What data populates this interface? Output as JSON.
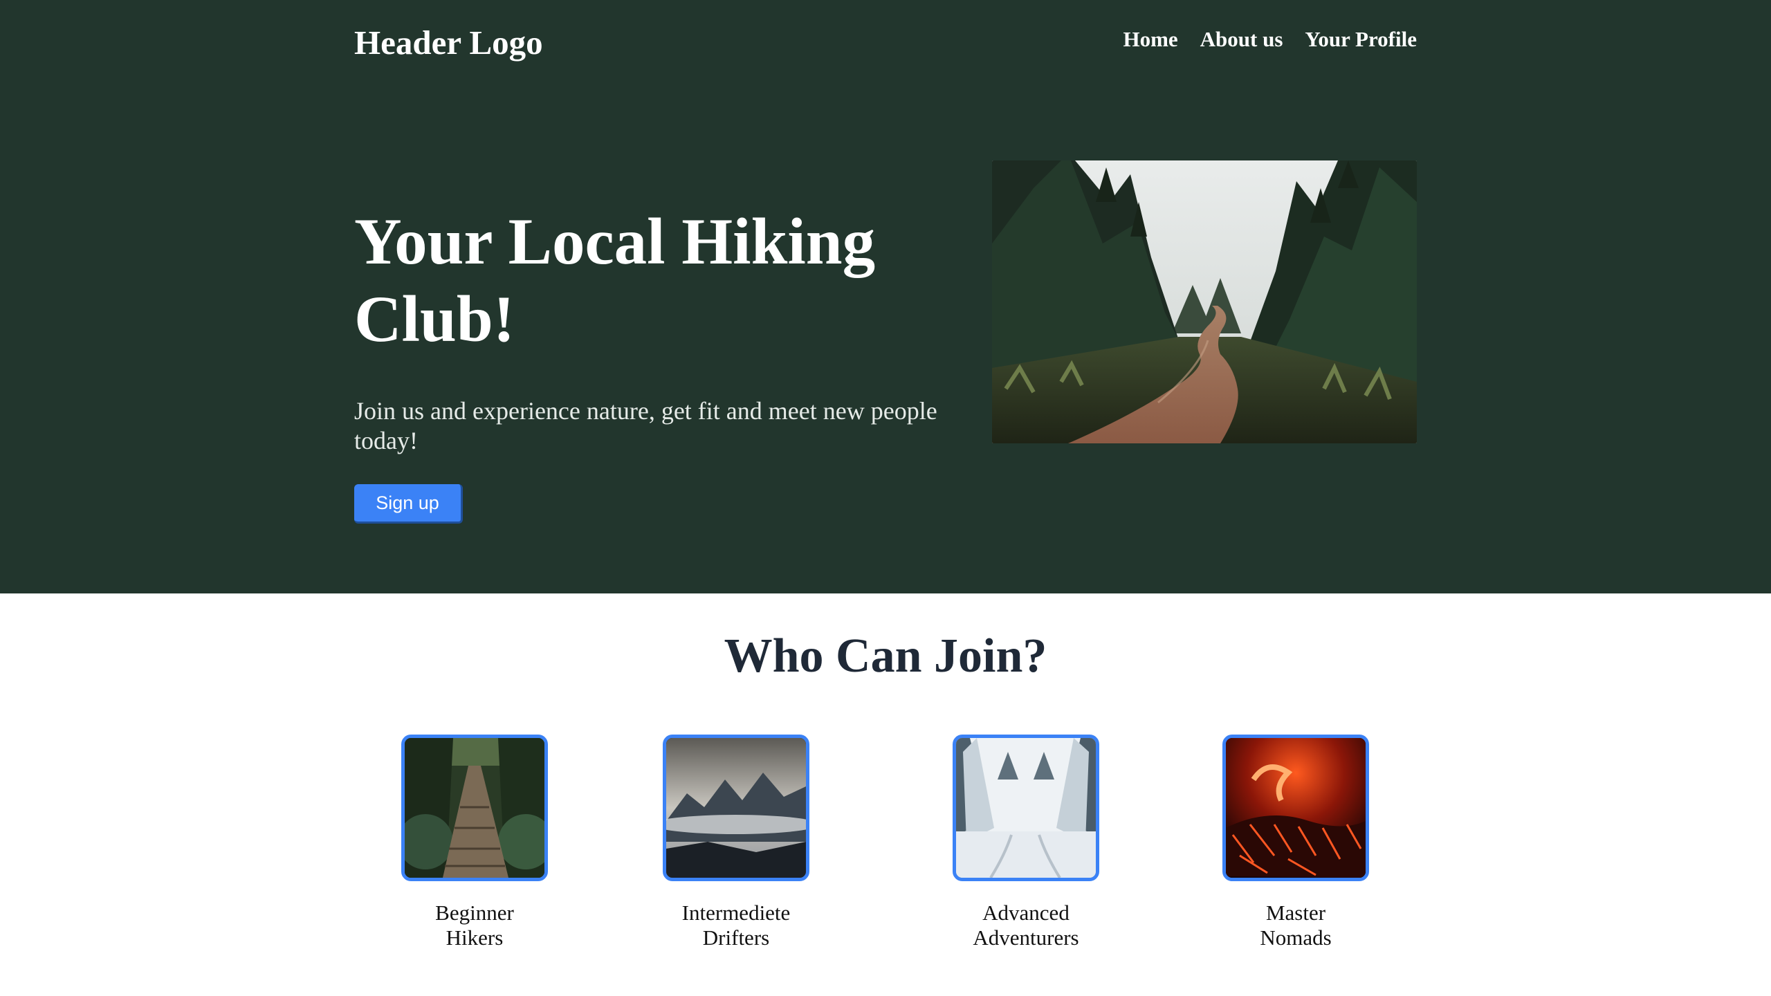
{
  "header": {
    "logo": "Header Logo",
    "nav": [
      "Home",
      "About us",
      "Your Profile"
    ]
  },
  "hero": {
    "title": "Your Local Hiking Club!",
    "subtitle": "Join us and experience nature, get fit and meet new people today!",
    "cta_label": "Sign up",
    "image": "forest-dirt-road-photo"
  },
  "join": {
    "title": "Who Can Join?",
    "tiles": [
      {
        "line1": "Beginner",
        "line2": "Hikers",
        "image": "forest-boardwalk-photo"
      },
      {
        "line1": "Intermediete",
        "line2": "Drifters",
        "image": "cloudy-mountains-photo"
      },
      {
        "line1": "Advanced",
        "line2": "Adventurers",
        "image": "snowy-forest-road-photo"
      },
      {
        "line1": "Master",
        "line2": "Nomads",
        "image": "lava-flow-photo"
      }
    ]
  },
  "colors": {
    "hero_bg": "#22362d",
    "accent": "#3b82f6",
    "heading_dark": "#1f2937"
  }
}
